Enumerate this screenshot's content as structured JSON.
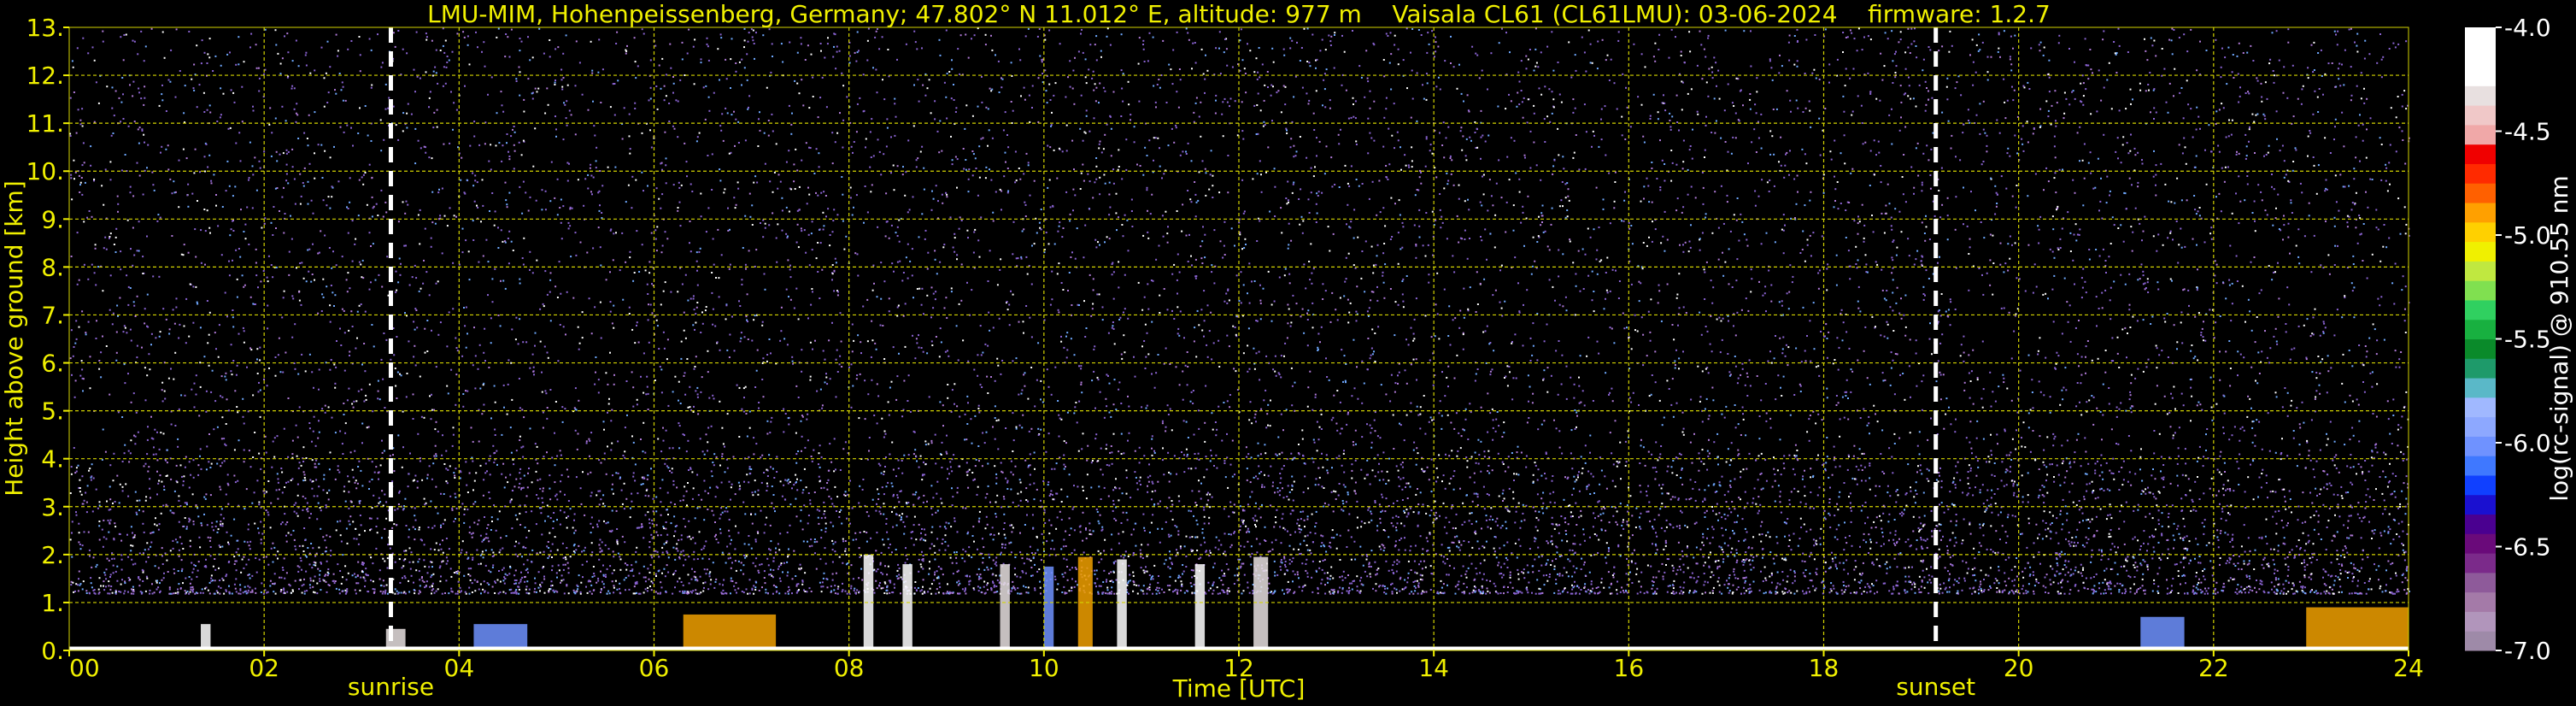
{
  "title": "LMU-MIM, Hohenpeissenberg, Germany; 47.802° N 11.012° E, altitude: 977 m    Vaisala CL61 (CL61LMU): 03-06-2024    firmware: 1.2.7",
  "colors": {
    "text": "#f0f000",
    "grid": "#d4d400",
    "background": "#000000",
    "event_line": "#ffffff",
    "noise_purple": "#8a63d2",
    "noise_blue": "#6fa9ff",
    "noise_white": "#ffffff"
  },
  "chart_data": {
    "type": "heatmap",
    "title": "LMU-MIM, Hohenpeissenberg, Germany; 47.802° N 11.012° E, altitude: 977 m    Vaisala CL61 (CL61LMU): 03-06-2024    firmware: 1.2.7",
    "xlabel": "Time [UTC]",
    "ylabel": "Height above ground [km]",
    "xlim": [
      0,
      24
    ],
    "ylim": [
      0,
      13
    ],
    "x_ticks": [
      0,
      2,
      4,
      6,
      8,
      10,
      12,
      14,
      16,
      18,
      20,
      22,
      24
    ],
    "x_tick_labels": [
      "00",
      "02",
      "04",
      "06",
      "08",
      "10",
      "12",
      "14",
      "16",
      "18",
      "20",
      "22",
      "24"
    ],
    "y_ticks": [
      0,
      1,
      2,
      3,
      4,
      5,
      6,
      7,
      8,
      9,
      10,
      11,
      12,
      13
    ],
    "y_tick_labels": [
      "0.",
      "1.",
      "2.",
      "3.",
      "4.",
      "5.",
      "6.",
      "7.",
      "8.",
      "9.",
      "10.",
      "11.",
      "12.",
      "13."
    ],
    "grid": true,
    "events": [
      {
        "label": "sunrise",
        "time": 3.3
      },
      {
        "label": "sunset",
        "time": 19.15
      }
    ],
    "colorbar": {
      "label": "log(rc-signal) @ 910.55 nm",
      "range": [
        -7.0,
        -4.0
      ],
      "tick_values": [
        -4.0,
        -4.5,
        -5.0,
        -5.5,
        -6.0,
        -6.5,
        -7.0
      ],
      "tick_labels": [
        "-4.0",
        "-4.5",
        "-5.0",
        "-5.5",
        "-6.0",
        "-6.5",
        "-7.0"
      ],
      "colors": [
        "#9e8aa8",
        "#b195bb",
        "#a47aa8",
        "#8e5a9a",
        "#7b2a8a",
        "#6a0a7a",
        "#4a0090",
        "#1a10d0",
        "#1040ff",
        "#3f78ff",
        "#6f92ff",
        "#8da8ff",
        "#a0b8ff",
        "#5ab8c8",
        "#1e9a6a",
        "#0a8a2a",
        "#18b040",
        "#30d060",
        "#80e050",
        "#c0e840",
        "#f0f000",
        "#ffd000",
        "#ffa000",
        "#ff6000",
        "#ff2a00",
        "#f00000",
        "#f0a8a8",
        "#f0c8c8",
        "#e8e0e0",
        "#ffffff",
        "#ffffff",
        "#ffffff"
      ]
    },
    "features": [
      {
        "time_start": 1.35,
        "time_end": 1.45,
        "height_top": 0.55
      },
      {
        "time_start": 3.25,
        "time_end": 3.45,
        "height_top": 0.45
      },
      {
        "time_start": 4.15,
        "time_end": 4.7,
        "height_top": 0.55
      },
      {
        "time_start": 6.3,
        "time_end": 7.25,
        "height_top": 0.75
      },
      {
        "time_start": 8.15,
        "time_end": 8.25,
        "height_top": 2.0
      },
      {
        "time_start": 8.55,
        "time_end": 8.65,
        "height_top": 1.8
      },
      {
        "time_start": 9.55,
        "time_end": 9.65,
        "height_top": 1.8
      },
      {
        "time_start": 10.0,
        "time_end": 10.1,
        "height_top": 1.75
      },
      {
        "time_start": 10.35,
        "time_end": 10.5,
        "height_top": 1.95
      },
      {
        "time_start": 10.75,
        "time_end": 10.85,
        "height_top": 1.9
      },
      {
        "time_start": 11.55,
        "time_end": 11.65,
        "height_top": 1.8
      },
      {
        "time_start": 12.15,
        "time_end": 12.3,
        "height_top": 1.95
      },
      {
        "time_start": 21.25,
        "time_end": 21.7,
        "height_top": 0.7
      },
      {
        "time_start": 22.95,
        "time_end": 24.0,
        "height_top": 0.9
      }
    ]
  }
}
